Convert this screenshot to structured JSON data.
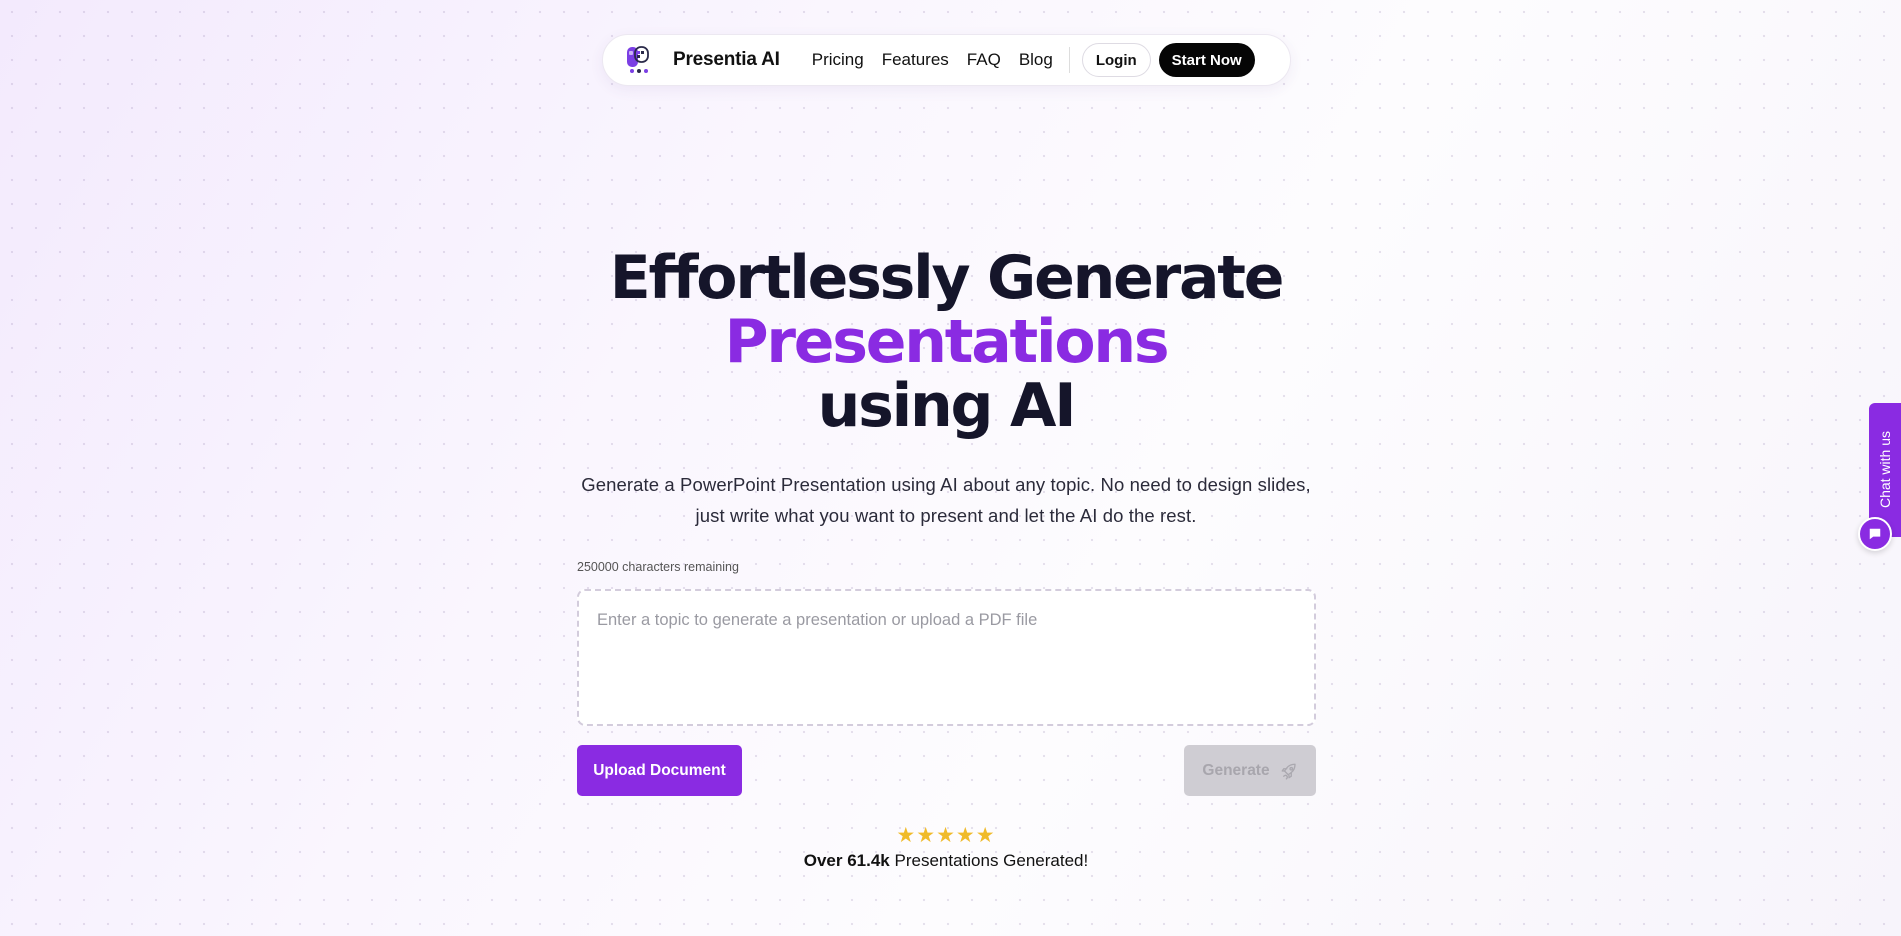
{
  "nav": {
    "brand": "Presentia AI",
    "links": [
      "Pricing",
      "Features",
      "FAQ",
      "Blog"
    ],
    "login_label": "Login",
    "start_label": "Start Now"
  },
  "hero": {
    "title_line1": "Effortlessly Generate",
    "title_line2": "Presentations",
    "title_line3": "using AI",
    "subtitle": "Generate a PowerPoint Presentation using AI about any topic. No need to design slides, just write what you want to present and let the AI do the rest."
  },
  "input": {
    "char_count": "250000 characters remaining",
    "placeholder": "Enter a topic to generate a presentation or upload a PDF file",
    "value": ""
  },
  "actions": {
    "upload_label": "Upload Document",
    "generate_label": "Generate"
  },
  "social_proof": {
    "stars": "★★★★★",
    "rating": 5,
    "prefix": "Over 61.4k",
    "suffix": " Presentations Generated!"
  },
  "chat": {
    "tab_label": "Chat with us"
  },
  "colors": {
    "accent": "#8a2be2",
    "dark": "#050505",
    "star": "#f0bb2a",
    "disabled": "#cfcdd3"
  },
  "icons": {
    "logo": "presentia-logo-icon",
    "generate": "rocket-icon",
    "chat": "chat-bubble-icon"
  }
}
